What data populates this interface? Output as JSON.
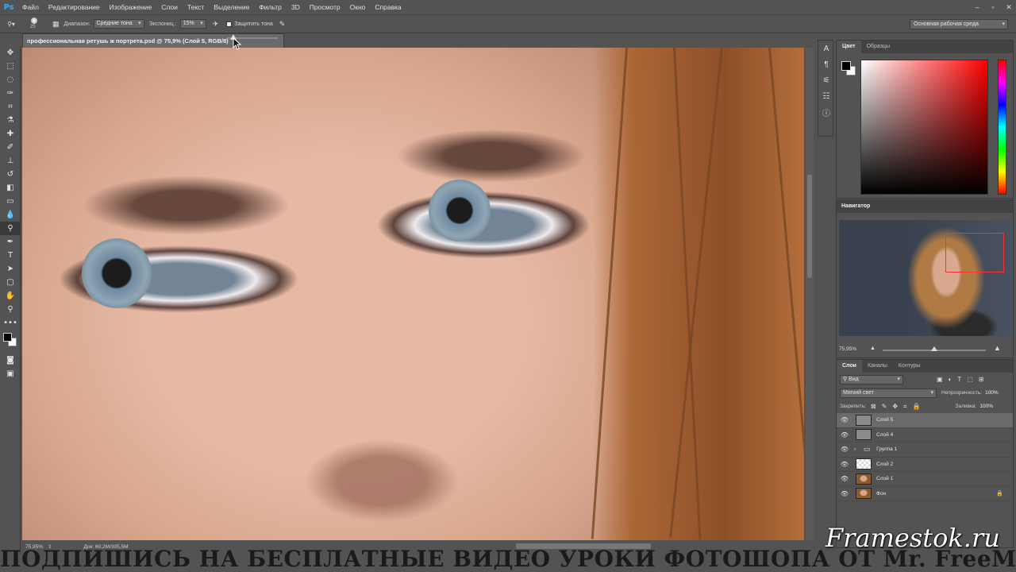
{
  "app": {
    "logo": "Ps"
  },
  "menu": [
    "Файл",
    "Редактирование",
    "Изображение",
    "Слои",
    "Текст",
    "Выделение",
    "Фильтр",
    "3D",
    "Просмотр",
    "Окно",
    "Справка"
  ],
  "options": {
    "brush_size": "25",
    "range_label": "Диапазон:",
    "range_value": "Средние тона",
    "exposure_label": "Экспониц.:",
    "exposure_value": "15%",
    "protect_tones": "Защитить тона",
    "workspace": "Основная рабочая среда"
  },
  "document": {
    "tab_title": "профессиональная ретушь ж портрета.psd @ 75,9% (Слой 5, RGB/8)",
    "zoom": "75,95%",
    "doc_info": "Док: 60,2M/305,5M"
  },
  "color_panel": {
    "tabs": [
      "Цвет",
      "Образцы"
    ],
    "fg": "#000000",
    "bg": "#ffffff"
  },
  "navigator": {
    "title": "Навигатор",
    "zoom": "75,95%",
    "zoom_fraction": 0.5
  },
  "layers_panel": {
    "tabs": [
      "Слои",
      "Каналы",
      "Контуры"
    ],
    "kind": "Вид",
    "blend_mode": "Мягкий свет",
    "opacity_label": "Непрозрачность:",
    "opacity_value": "100%",
    "lock_label": "Закрепить:",
    "fill_label": "Заливка:",
    "fill_value": "100%",
    "layers": [
      {
        "name": "Слой 5",
        "thumb": "gray",
        "selected": true
      },
      {
        "name": "Слой 4",
        "thumb": "gray",
        "selected": false
      },
      {
        "name": "Группа 1",
        "thumb": "folder",
        "selected": false
      },
      {
        "name": "Слой 2",
        "thumb": "checker",
        "selected": false
      },
      {
        "name": "Слой 1",
        "thumb": "photo",
        "selected": false
      },
      {
        "name": "Фон",
        "thumb": "photo",
        "selected": false,
        "locked": true
      }
    ]
  },
  "overlay": {
    "subtitle": "ПОДПИШИСЬ НА БЕСПЛАТНЫЕ ВИДЕО УРОКИ ФОТОШОПА ОТ Mr. FreeMax!",
    "watermark": "Framestok.ru"
  }
}
